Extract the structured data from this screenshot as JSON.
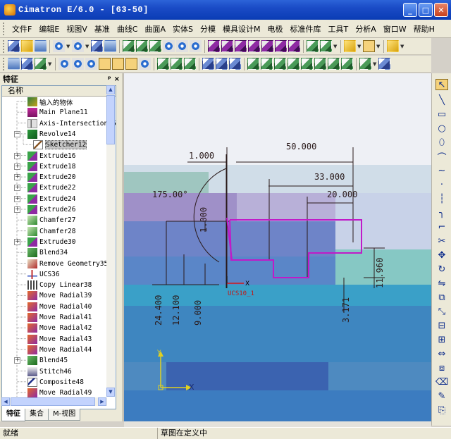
{
  "window": {
    "title": "Cimatron E/6.0 - [63-50]",
    "min_label": "_",
    "max_label": "□",
    "close_label": "✕"
  },
  "menu": {
    "items": [
      "文件F",
      "编辑E",
      "视图V",
      "基准",
      "曲线C",
      "曲面A",
      "实体S",
      "分模",
      "模具设计M",
      "电极",
      "标准件库",
      "工具T",
      "分析A",
      "窗口W",
      "帮助H"
    ],
    "mdi_controls": "_ ×\n□ ×"
  },
  "panel": {
    "title": "特征",
    "pin": "ᵖ",
    "close": "×",
    "column_header": "名称",
    "tabs": [
      "特征",
      "集合",
      "M-视图"
    ]
  },
  "tree": [
    {
      "label": "输入的物体",
      "icon": "import-icon",
      "expander": ""
    },
    {
      "label": "Main Plane11",
      "icon": "plane-icon",
      "expander": ""
    },
    {
      "label": "Axis-Intersection15",
      "icon": "axis-icon",
      "expander": ""
    },
    {
      "label": "Revolve14",
      "icon": "revolve-icon",
      "expander": "−"
    },
    {
      "label": "Sketcher12",
      "icon": "sketch-icon",
      "expander": "",
      "selected": true
    },
    {
      "label": "Extrude16",
      "icon": "extrude-icon",
      "expander": "+"
    },
    {
      "label": "Extrude18",
      "icon": "extrude-icon",
      "expander": "+"
    },
    {
      "label": "Extrude20",
      "icon": "extrude-icon",
      "expander": "+"
    },
    {
      "label": "Extrude22",
      "icon": "extrude-icon",
      "expander": "+"
    },
    {
      "label": "Extrude24",
      "icon": "extrude-icon",
      "expander": "+"
    },
    {
      "label": "Extrude26",
      "icon": "extrude-icon",
      "expander": "+"
    },
    {
      "label": "Chamfer27",
      "icon": "chamfer-icon",
      "expander": ""
    },
    {
      "label": "Chamfer28",
      "icon": "chamfer-icon",
      "expander": ""
    },
    {
      "label": "Extrude30",
      "icon": "extrude-icon",
      "expander": "+"
    },
    {
      "label": "Blend34",
      "icon": "blend-icon",
      "expander": ""
    },
    {
      "label": "Remove Geometry35",
      "icon": "remove-geometry-icon",
      "expander": ""
    },
    {
      "label": "UCS36",
      "icon": "ucs-icon",
      "expander": ""
    },
    {
      "label": "Copy Linear38",
      "icon": "copy-linear-icon",
      "expander": ""
    },
    {
      "label": "Move Radial39",
      "icon": "move-radial-icon",
      "expander": ""
    },
    {
      "label": "Move Radial40",
      "icon": "move-radial-icon",
      "expander": ""
    },
    {
      "label": "Move Radial41",
      "icon": "move-radial-icon",
      "expander": ""
    },
    {
      "label": "Move Radial42",
      "icon": "move-radial-icon",
      "expander": ""
    },
    {
      "label": "Move Radial43",
      "icon": "move-radial-icon",
      "expander": ""
    },
    {
      "label": "Move Radial44",
      "icon": "move-radial-icon",
      "expander": ""
    },
    {
      "label": "Blend45",
      "icon": "blend-icon",
      "expander": "+"
    },
    {
      "label": "Stitch46",
      "icon": "stitch-icon",
      "expander": ""
    },
    {
      "label": "Composite48",
      "icon": "composite-icon",
      "expander": ""
    },
    {
      "label": "Move Radial49",
      "icon": "move-radial-icon",
      "expander": ""
    }
  ],
  "sketch": {
    "dims": [
      "1.000",
      "50.000",
      "33.000",
      "20.000",
      "175.00°",
      "1.000",
      "11.960",
      "24.400",
      "12.100",
      "9.000",
      "3.171"
    ],
    "x_axis_label": "X",
    "ucs_label": "UCS10_1",
    "ucs_x": "X",
    "ucs_y": "Y",
    "profile_color": "#c01ac8",
    "dimension_color": "#2a1a1a"
  },
  "statusbar": {
    "left": "就绪",
    "right": "草图在定义中"
  }
}
